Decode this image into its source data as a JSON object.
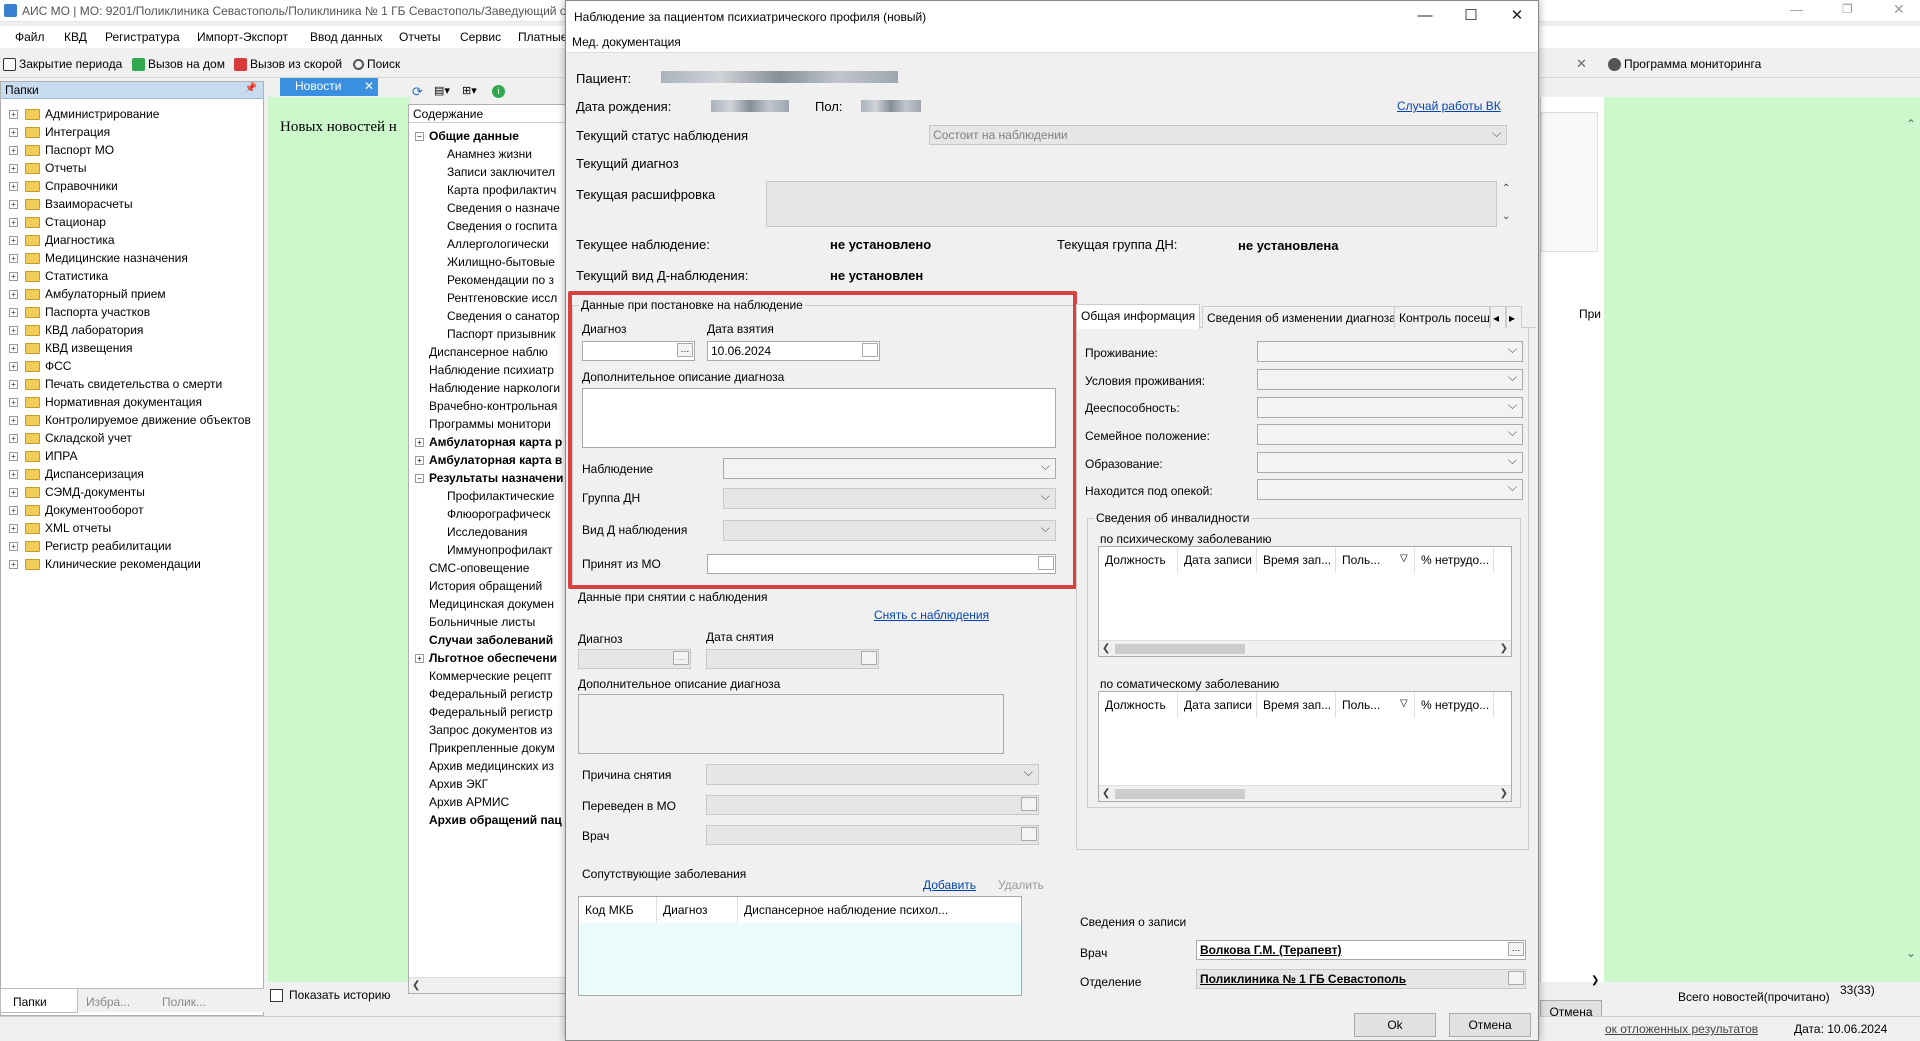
{
  "app": {
    "title": "АИС МО | МО: 9201/Поликлиника Севастополь/Поликлиника № 1 ГБ Севастополь/Заведующий о"
  },
  "menu": [
    "Файл",
    "КВД",
    "Регистратура",
    "Импорт-Экспорт",
    "Ввод данных",
    "Отчеты",
    "Сервис",
    "Платные"
  ],
  "toolbar": {
    "close_period": "Закрытие периода",
    "home_call": "Вызов на дом",
    "ambulance_call": "Вызов из скорой",
    "search": "Поиск",
    "monitoring": "Программа мониторинга"
  },
  "left_panel": {
    "header": "Папки",
    "items": [
      "Администрирование",
      "Интеграция",
      "Паспорт МО",
      "Отчеты",
      "Справочники",
      "Взаиморасчеты",
      "Стационар",
      "Диагностика",
      "Медицинские назначения",
      "Статистика",
      "Амбулаторный прием",
      "Паспорта участков",
      "КВД лаборатория",
      "КВД извещения",
      "ФСС",
      "Печать свидетельства о смерти",
      "Нормативная документация",
      "Контролируемое движение объектов",
      "Складской учет",
      "ИПРА",
      "Диспансеризация",
      "СЭМД-документы",
      "Документооборот",
      "XML отчеты",
      "Регистр реабилитации",
      "Клинические рекомендации"
    ],
    "bottom_tabs": [
      "Папки",
      "Избра...",
      "Полик..."
    ]
  },
  "news": {
    "tab": "Новости",
    "text": "Новых новостей н",
    "show_history": "Показать историю"
  },
  "mid_panel": {
    "header": "Содержание",
    "items": [
      {
        "label": "Общие данные",
        "bold": true,
        "indent": 0,
        "exp": "−"
      },
      {
        "label": "Анамнез жизни",
        "indent": 1
      },
      {
        "label": "Записи заключител",
        "indent": 1
      },
      {
        "label": "Карта профилактич",
        "indent": 1
      },
      {
        "label": "Сведения о назначе",
        "indent": 1
      },
      {
        "label": "Сведения о госпита",
        "indent": 1
      },
      {
        "label": "Аллергологически",
        "indent": 1
      },
      {
        "label": "Жилищно-бытовые",
        "indent": 1
      },
      {
        "label": "Рекомендации по з",
        "indent": 1
      },
      {
        "label": "Рентгеновские иссл",
        "indent": 1
      },
      {
        "label": "Сведения о санатор",
        "indent": 1
      },
      {
        "label": "Паспорт призывник",
        "indent": 1
      },
      {
        "label": "Диспансерное наблю",
        "indent": 0
      },
      {
        "label": "Наблюдение психиатр",
        "indent": 0
      },
      {
        "label": "Наблюдение наркологи",
        "indent": 0
      },
      {
        "label": "Врачебно-контрольная",
        "indent": 0
      },
      {
        "label": "Программы монитори",
        "indent": 0
      },
      {
        "label": "Амбулаторная карта р",
        "bold": true,
        "indent": 0,
        "exp": "+"
      },
      {
        "label": "Амбулаторная карта в",
        "bold": true,
        "indent": 0,
        "exp": "+"
      },
      {
        "label": "Результаты назначени",
        "bold": true,
        "indent": 0,
        "exp": "−"
      },
      {
        "label": "Профилактические",
        "indent": 1
      },
      {
        "label": "Флюорографическ",
        "indent": 1
      },
      {
        "label": "Исследования",
        "indent": 1
      },
      {
        "label": "Иммунопрофилакт",
        "indent": 1
      },
      {
        "label": "СМС-оповещение",
        "indent": 0
      },
      {
        "label": "История обращений",
        "indent": 0
      },
      {
        "label": "Медицинская докумен",
        "indent": 0
      },
      {
        "label": "Больничные листы",
        "indent": 0
      },
      {
        "label": "Случаи заболеваний",
        "bold": true,
        "indent": 0
      },
      {
        "label": "Льготное обеспечени",
        "bold": true,
        "indent": 0,
        "exp": "+"
      },
      {
        "label": "Коммерческие рецепт",
        "indent": 0
      },
      {
        "label": "Федеральный регистр",
        "indent": 0
      },
      {
        "label": "Федеральный регистр",
        "indent": 0
      },
      {
        "label": "Запрос документов из",
        "indent": 0
      },
      {
        "label": "Прикрепленные докум",
        "indent": 0
      },
      {
        "label": "Архив медицинских из",
        "indent": 0
      },
      {
        "label": "Архив ЭКГ",
        "indent": 0
      },
      {
        "label": "Архив АРМИС",
        "indent": 0
      },
      {
        "label": "Архив обращений пац",
        "bold": true,
        "indent": 0
      }
    ]
  },
  "dialog": {
    "title": "Наблюдение за пациентом психиатрического профиля (новый)",
    "menu": "Мед. документация",
    "patient_label": "Пациент:",
    "dob_label": "Дата рождения:",
    "sex_label": "Пол:",
    "vk_link": "Случай работы ВК",
    "status_label": "Текущий статус наблюдения",
    "status_value": "Состоит на наблюдении",
    "diag_label": "Текущий диагноз",
    "decode_label": "Текущая расшифровка",
    "cur_obs_label": "Текущее наблюдение:",
    "cur_obs_value": "не установлено",
    "cur_group_label": "Текущая группа ДН:",
    "cur_group_value": "не установлена",
    "cur_type_label": "Текущий вид Д-наблюдения:",
    "cur_type_value": "не установлен",
    "reg": {
      "title": "Данные при постановке на наблюдение",
      "diag": "Диагноз",
      "date": "Дата взятия",
      "date_value": "10.06.2024",
      "extra": "Дополнительное описание диагноза",
      "obs": "Наблюдение",
      "group": "Группа ДН",
      "type": "Вид Д наблюдения",
      "from": "Принят из МО"
    },
    "unreg": {
      "title": "Данные при снятии с наблюдения",
      "link": "Снять с наблюдения",
      "diag": "Диагноз",
      "date": "Дата снятия",
      "extra": "Дополнительное описание диагноза",
      "reason": "Причина снятия",
      "moved": "Переведен в МО",
      "doctor": "Врач"
    },
    "comorb": {
      "title": "Сопутствующие заболевания",
      "add": "Добавить",
      "del": "Удалить",
      "cols": [
        "Код МКБ",
        "Диагноз",
        "Диспансерное наблюдение психол..."
      ]
    },
    "tabs": [
      "Общая информация",
      "Сведения об изменении диагноза",
      "Контроль посещени"
    ],
    "info": {
      "living": "Проживание:",
      "conditions": "Условия проживания:",
      "capacity": "Дееспособность:",
      "family": "Семейное положение:",
      "education": "Образование:",
      "guardian": "Находится под опекой:"
    },
    "disability": {
      "title": "Сведения об инвалидности",
      "psych": "по психическому заболеванию",
      "somatic": "по соматическому заболеванию",
      "cols": [
        "Должность",
        "Дата записи",
        "Время зап...",
        "Поль...",
        "% нетрудо..."
      ]
    },
    "record": {
      "title": "Сведения о записи",
      "doctor_label": "Врач",
      "doctor_value": "Волкова Г.М. (Терапевт)",
      "dept_label": "Отделение",
      "dept_value": "Поликлиника № 1 ГБ Севастополь"
    },
    "ok": "Ok",
    "cancel": "Отмена"
  },
  "right": {
    "pri": "При",
    "total_news": "Всего новостей(прочитано)",
    "count": "33(33)",
    "cancel_btn": "Отмена"
  },
  "status": {
    "deferred": "ок отложенных результатов",
    "date": "Дата: 10.06.2024"
  }
}
